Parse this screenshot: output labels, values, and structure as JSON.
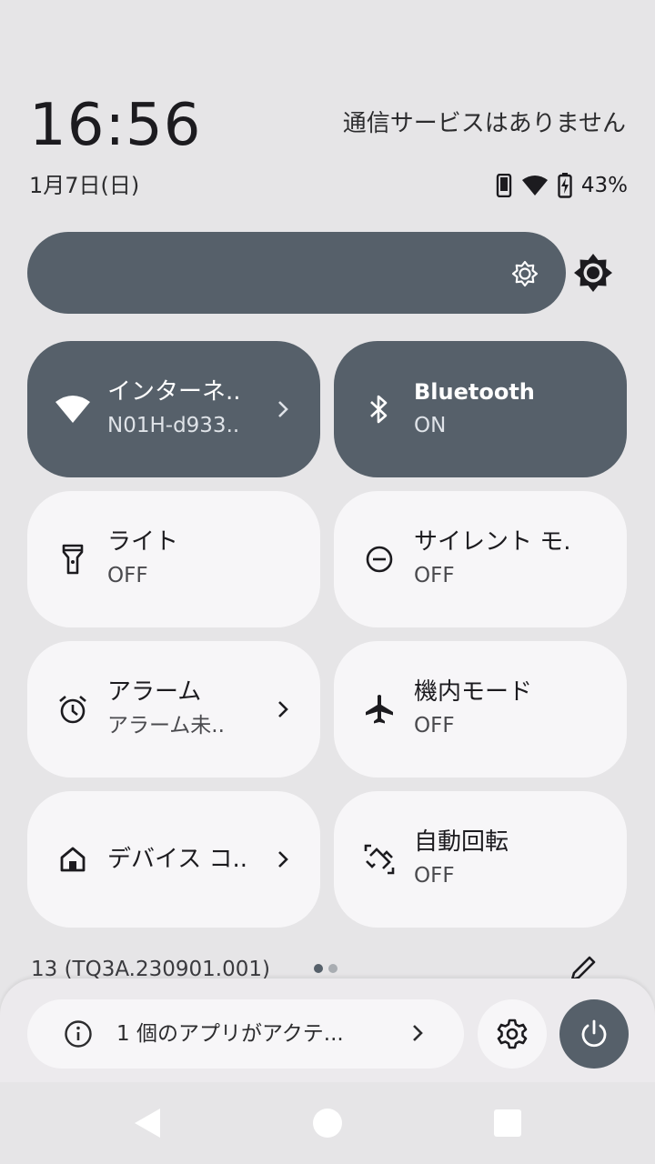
{
  "header": {
    "time": "16:56",
    "carrier": "通信サービスはありません",
    "date": "1月7日(日)",
    "battery_percent": "43%"
  },
  "brightness": {
    "level": 1.0
  },
  "tiles": [
    {
      "title": "インターネ..",
      "subtitle": "N01H-d933..",
      "icon": "wifi-icon",
      "active": true,
      "chevron": true
    },
    {
      "title": "Bluetooth",
      "subtitle": "ON",
      "icon": "bluetooth-icon",
      "active": true,
      "chevron": false
    },
    {
      "title": "ライト",
      "subtitle": "OFF",
      "icon": "flashlight-icon",
      "active": false,
      "chevron": false
    },
    {
      "title": "サイレント モ..",
      "subtitle": "OFF",
      "icon": "do-not-disturb-icon",
      "active": false,
      "chevron": false
    },
    {
      "title": "アラーム",
      "subtitle": "アラーム未..",
      "icon": "alarm-icon",
      "active": false,
      "chevron": true
    },
    {
      "title": "機内モード",
      "subtitle": "OFF",
      "icon": "airplane-icon",
      "active": false,
      "chevron": false
    },
    {
      "title": "デバイス コ..",
      "subtitle": "",
      "icon": "home-icon",
      "active": false,
      "chevron": true
    },
    {
      "title": "自動回転",
      "subtitle": "OFF",
      "icon": "auto-rotate-icon",
      "active": false,
      "chevron": false
    }
  ],
  "footer": {
    "build": "13 (TQ3A.230901.001)",
    "security_text": "1 個のアプリがアクテ..."
  },
  "colors": {
    "active_tile": "#56606a",
    "inactive_tile": "#f7f6f8",
    "background": "#e6e5e7"
  }
}
